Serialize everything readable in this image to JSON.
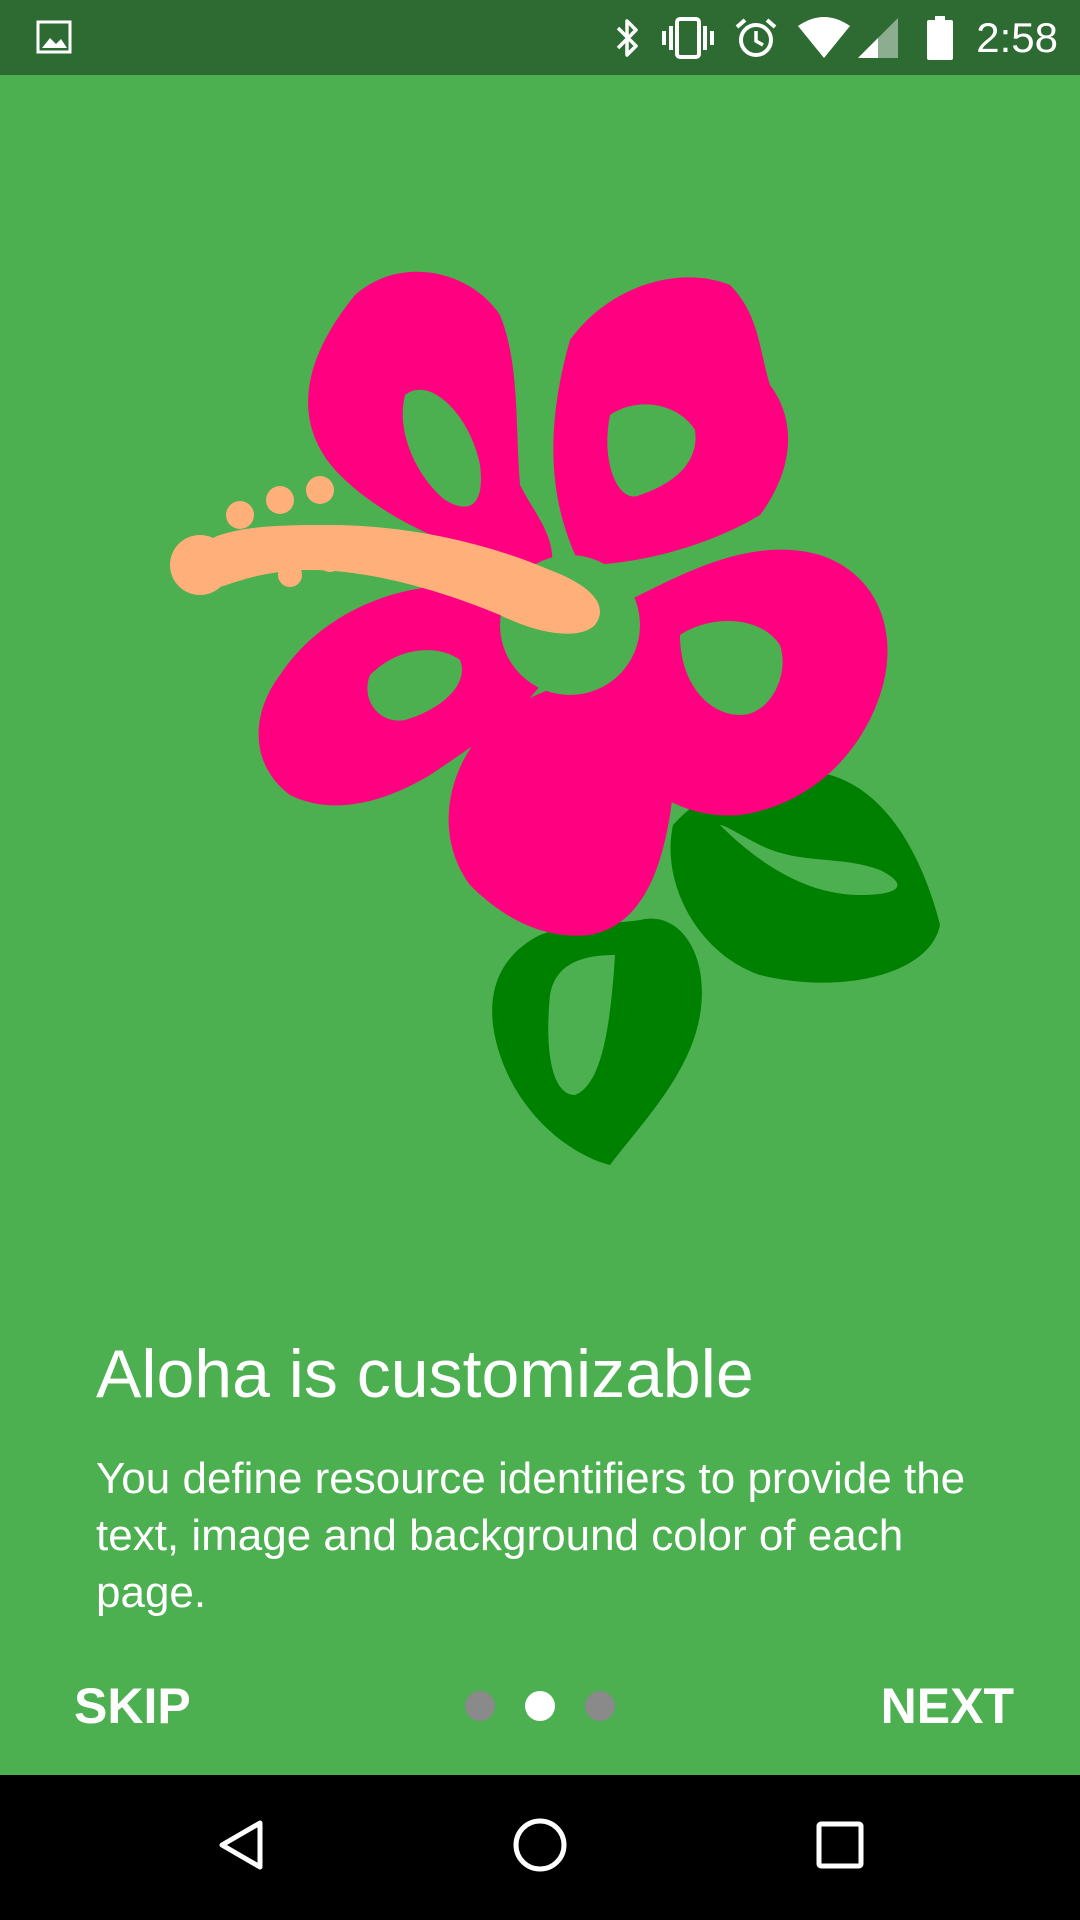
{
  "status_bar": {
    "time": "2:58",
    "icons": [
      "image-icon",
      "bluetooth-icon",
      "vibrate-icon",
      "alarm-icon",
      "wifi-icon",
      "cell-signal-icon",
      "battery-icon"
    ]
  },
  "intro": {
    "title": "Aloha is customizable",
    "description": "You define resource identifiers to provide the text, image and background color of each page.",
    "background_color": "#4caf50",
    "illustration": "hibiscus-flower"
  },
  "footer": {
    "skip_label": "SKIP",
    "next_label": "NEXT",
    "page_count": 3,
    "current_page": 2
  },
  "colors": {
    "status_bar": "#2e6b33",
    "petal": "#ff0080",
    "stamen": "#ffb07a",
    "leaf": "#008000",
    "dot_active": "#ffffff",
    "dot_inactive": "#8a8a8a"
  },
  "nav_bar": {
    "icons": [
      "back-icon",
      "home-icon",
      "recents-icon"
    ]
  }
}
